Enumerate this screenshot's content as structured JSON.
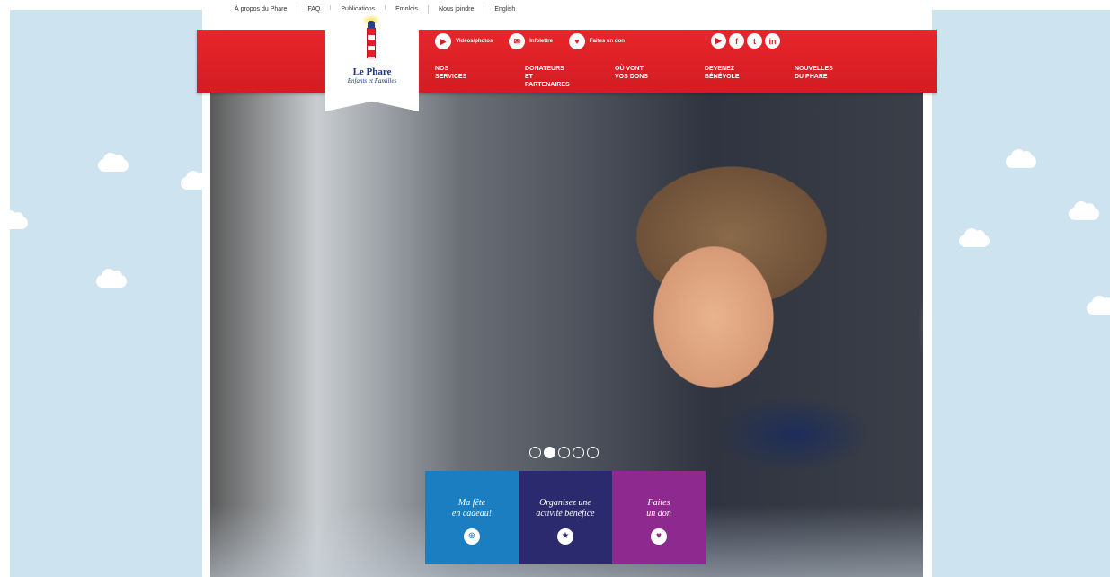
{
  "top_nav": [
    "À propos du Phare",
    "FAQ",
    "Publications",
    "Emplois",
    "Nous joindre",
    "English"
  ],
  "utility": [
    {
      "label": "Vidéos/photos",
      "icon": "play-icon"
    },
    {
      "label": "Infolettre",
      "icon": "mail-icon"
    },
    {
      "label": "Faites un don",
      "icon": "heart-icon"
    }
  ],
  "social": [
    "youtube-icon",
    "facebook-icon",
    "twitter-icon",
    "linkedin-icon"
  ],
  "main_nav": [
    {
      "line1": "NOS",
      "line2": "SERVICES"
    },
    {
      "line1": "DONATEURS",
      "line2": "ET PARTENAIRES"
    },
    {
      "line1": "OÙ VONT",
      "line2": "VOS DONS"
    },
    {
      "line1": "DEVENEZ",
      "line2": "BÉNÉVOLE"
    },
    {
      "line1": "NOUVELLES",
      "line2": "DU PHARE"
    }
  ],
  "logo": {
    "title": "Le Phare",
    "subtitle": "Enfants et Familles"
  },
  "slider": {
    "count": 5,
    "active": 1
  },
  "cta": [
    {
      "line1": "Ma fête",
      "line2": "en cadeau!",
      "icon": "gift-icon"
    },
    {
      "line1": "Organisez une",
      "line2": "activité bénéfice",
      "icon": "star-icon"
    },
    {
      "line1": "Faites",
      "line2": "un don",
      "icon": "heart-icon"
    }
  ],
  "colors": {
    "red": "#d21d23",
    "sky": "#cde3f0",
    "blue": "#1a7ec0",
    "navy": "#2b2a6e",
    "purple": "#8e2a8f"
  }
}
